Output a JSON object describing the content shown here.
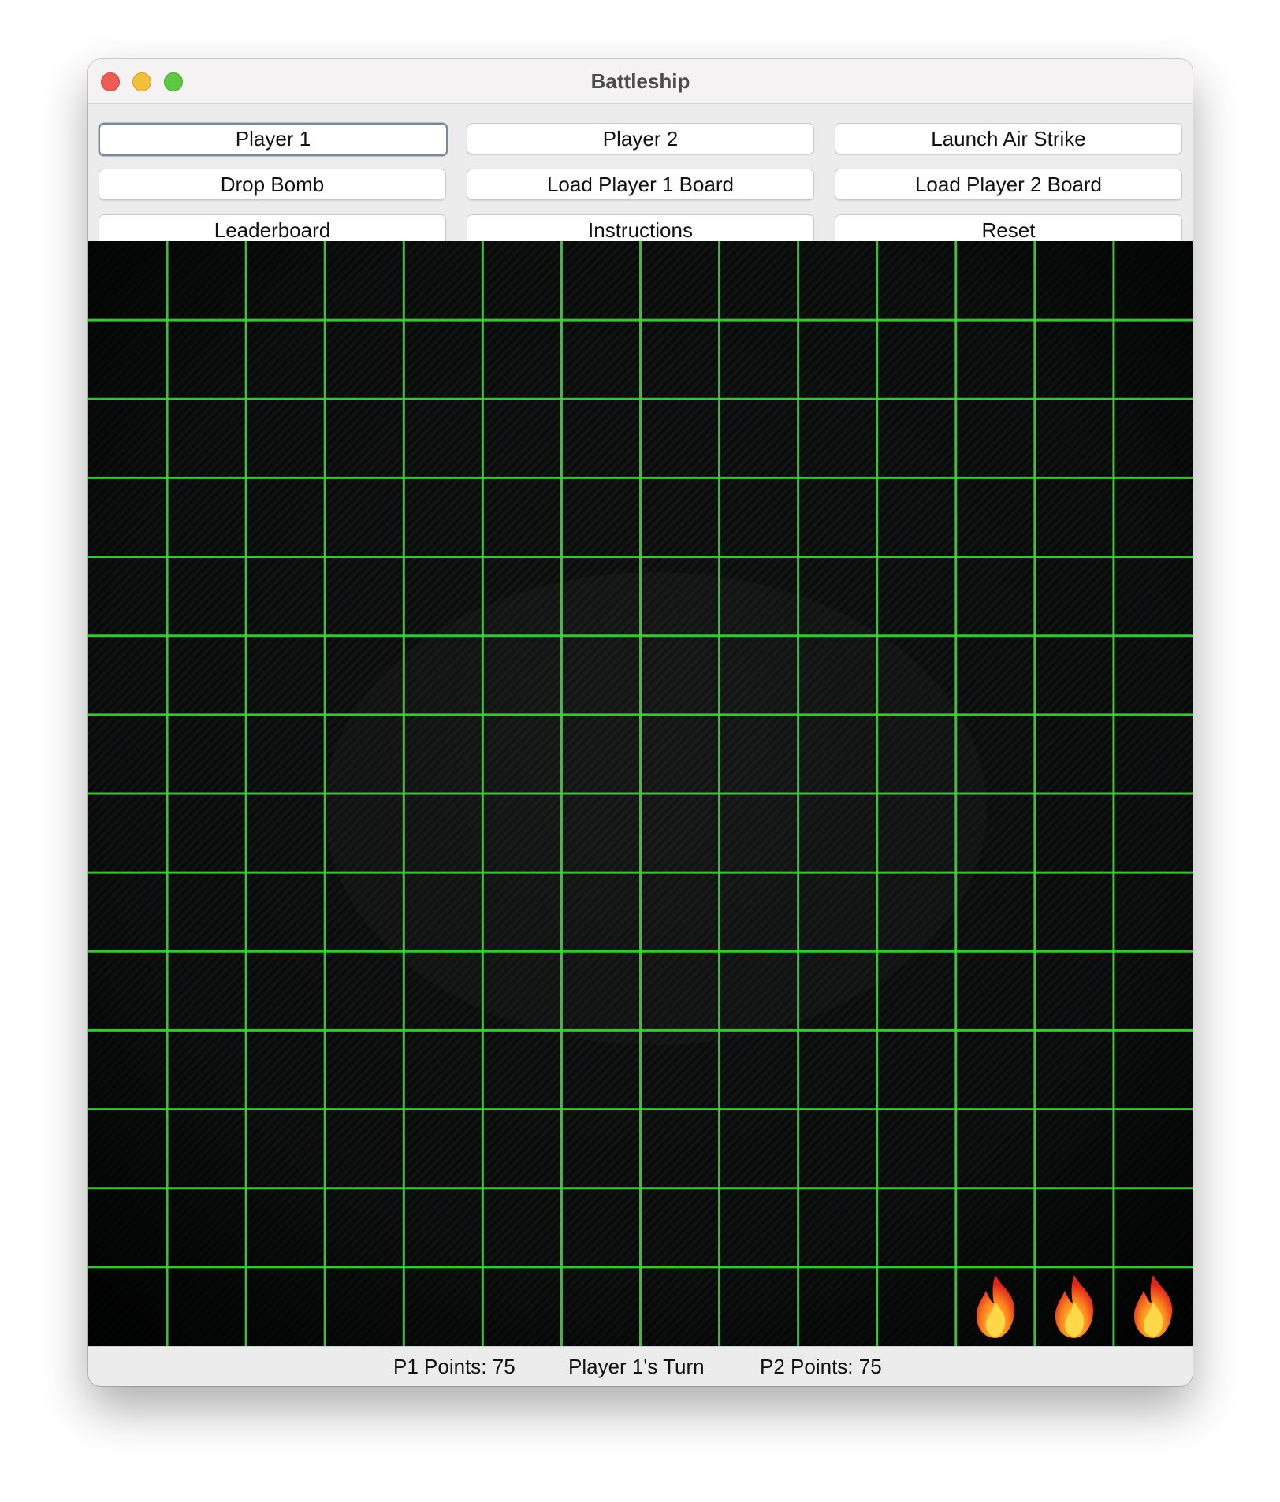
{
  "window": {
    "title": "Battleship"
  },
  "buttons": [
    {
      "label": "Player 1",
      "focused": true
    },
    {
      "label": "Player 2"
    },
    {
      "label": "Launch Air Strike"
    },
    {
      "label": "Drop Bomb"
    },
    {
      "label": "Load Player 1 Board"
    },
    {
      "label": "Load Player 2 Board"
    },
    {
      "label": "Leaderboard"
    },
    {
      "label": "Instructions"
    },
    {
      "label": "Reset"
    }
  ],
  "board": {
    "rows": 14,
    "cols": 14,
    "grid_color": "#41d53b",
    "background_color": "#050a05",
    "markers": [
      {
        "icon": "fire-icon",
        "row": 14,
        "col": 12
      },
      {
        "icon": "fire-icon",
        "row": 14,
        "col": 13
      },
      {
        "icon": "fire-icon",
        "row": 14,
        "col": 14
      }
    ]
  },
  "status": {
    "p1_points": "P1 Points: 75",
    "turn": "Player 1's Turn",
    "p2_points": "P2 Points: 75"
  },
  "colors": {
    "close": "#ee5b54",
    "minimize": "#f4bd3c",
    "maximize": "#5ec844"
  }
}
